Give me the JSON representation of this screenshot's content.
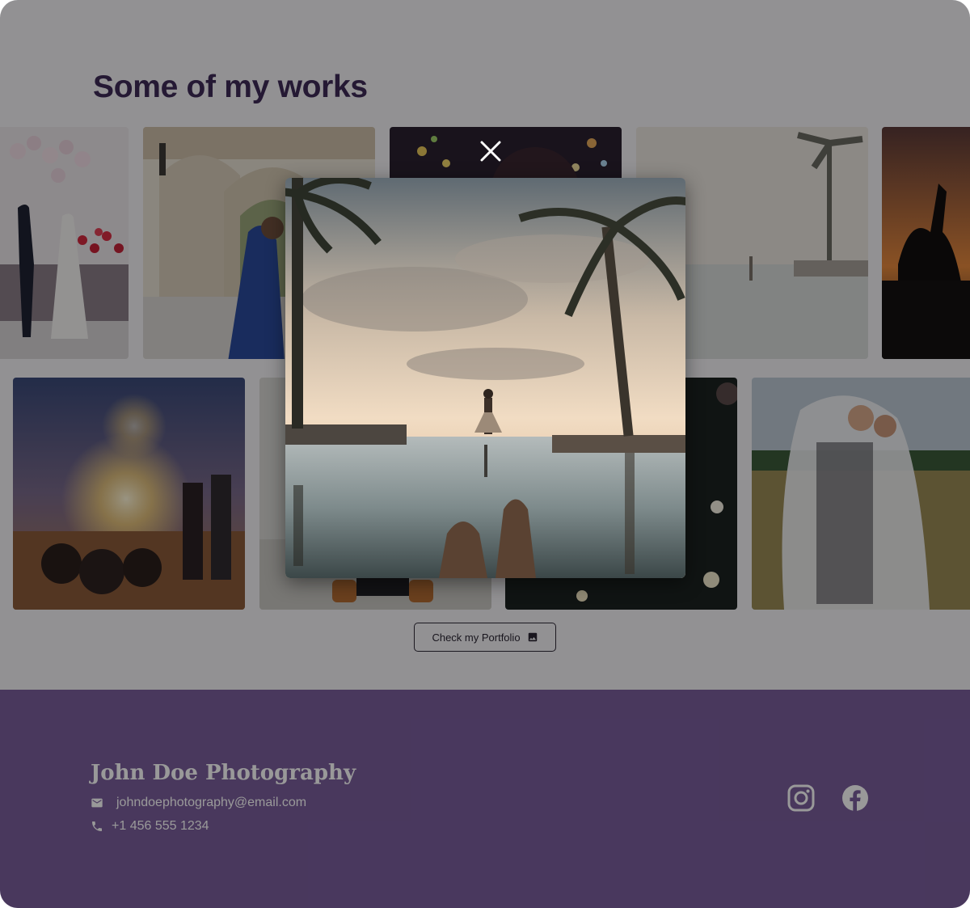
{
  "works": {
    "title": "Some of my works",
    "portfolio_button": "Check my Portfolio",
    "gallery": [
      {
        "name": "wedding-balloons",
        "alt": "Couple celebrating with red balloons"
      },
      {
        "name": "archway-bride",
        "alt": "Bride walking under stone arches"
      },
      {
        "name": "bokeh-portrait",
        "alt": "Portrait with bokeh lights"
      },
      {
        "name": "infinity-pool",
        "alt": "Woman at infinity pool with palm trees"
      },
      {
        "name": "sunset-silhouette",
        "alt": "Silhouettes at sunset"
      },
      {
        "name": "sparklers-beach",
        "alt": "Sparklers on a beach at dusk"
      },
      {
        "name": "shoes-floor",
        "alt": "Shoes on tiled floor"
      },
      {
        "name": "dark-lights",
        "alt": "Dark scene with lights"
      },
      {
        "name": "veil-couple",
        "alt": "Couple embracing under a veil in a field"
      }
    ]
  },
  "modal": {
    "image_alt": "Woman standing at the edge of an infinity pool between palm trees at sunset",
    "close_icon": "close-icon"
  },
  "footer": {
    "brand": "John Doe Photography",
    "email": "johndoephotography@email.com",
    "phone": "+1 456 555 1234",
    "icons": [
      "mail-icon",
      "phone-icon",
      "instagram-icon",
      "facebook-icon"
    ]
  },
  "colors": {
    "title": "#3e2b57",
    "footer_bg": "#7a5e9c",
    "overlay": "rgba(0,0,0,0.40)"
  }
}
